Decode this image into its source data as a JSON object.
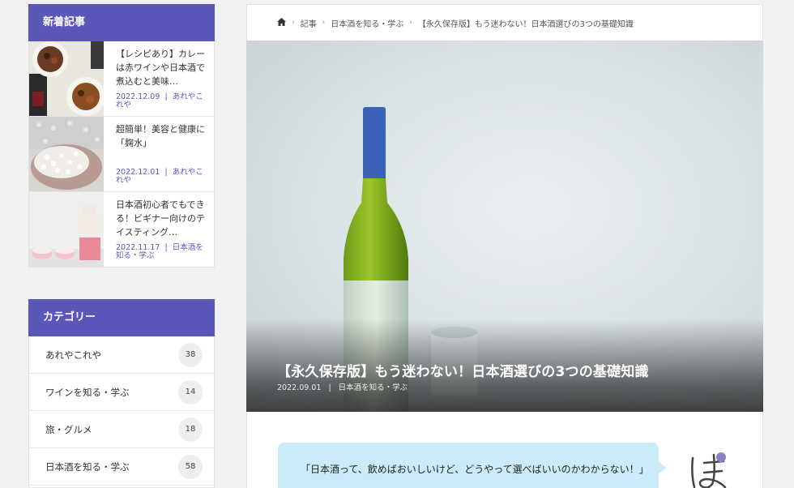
{
  "sidebar": {
    "recent": {
      "heading": "新着記事",
      "posts": [
        {
          "title": "【レシピあり】カレーは赤ワインや日本酒で煮込むと美味…",
          "date": "2022.12.09",
          "category": "あれやこれや"
        },
        {
          "title": "超簡単！美容と健康に「麹水」",
          "date": "2022.12.01",
          "category": "あれやこれや"
        },
        {
          "title": "日本酒初心者でもできる！ビギナー向けのテイスティング…",
          "date": "2022.11.17",
          "category": "日本酒を知る・学ぶ"
        }
      ]
    },
    "categories": {
      "heading": "カテゴリー",
      "items": [
        {
          "label": "あれやこれや",
          "count": "38"
        },
        {
          "label": "ワインを知る・学ぶ",
          "count": "14"
        },
        {
          "label": "旅・グルメ",
          "count": "18"
        },
        {
          "label": "日本酒を知る・学ぶ",
          "count": "58"
        }
      ]
    }
  },
  "main": {
    "breadcrumb": {
      "home_icon": "home-icon",
      "items": [
        "記事",
        "日本酒を知る・学ぶ",
        "【永久保存版】もう迷わない！日本酒選びの3つの基礎知識"
      ]
    },
    "hero": {
      "title": "【永久保存版】もう迷わない！日本酒選びの3つの基礎知識",
      "date": "2022.09.01",
      "category": "日本酒を知る・学ぶ"
    },
    "balloon": {
      "text": "「日本酒って、飲めばおいしいけど、どうやって選べばいいのかわからない！」"
    }
  },
  "colors": {
    "accent": "#5b57b8",
    "balloon": "#c9ecf8",
    "background": "#f2f2f2"
  }
}
